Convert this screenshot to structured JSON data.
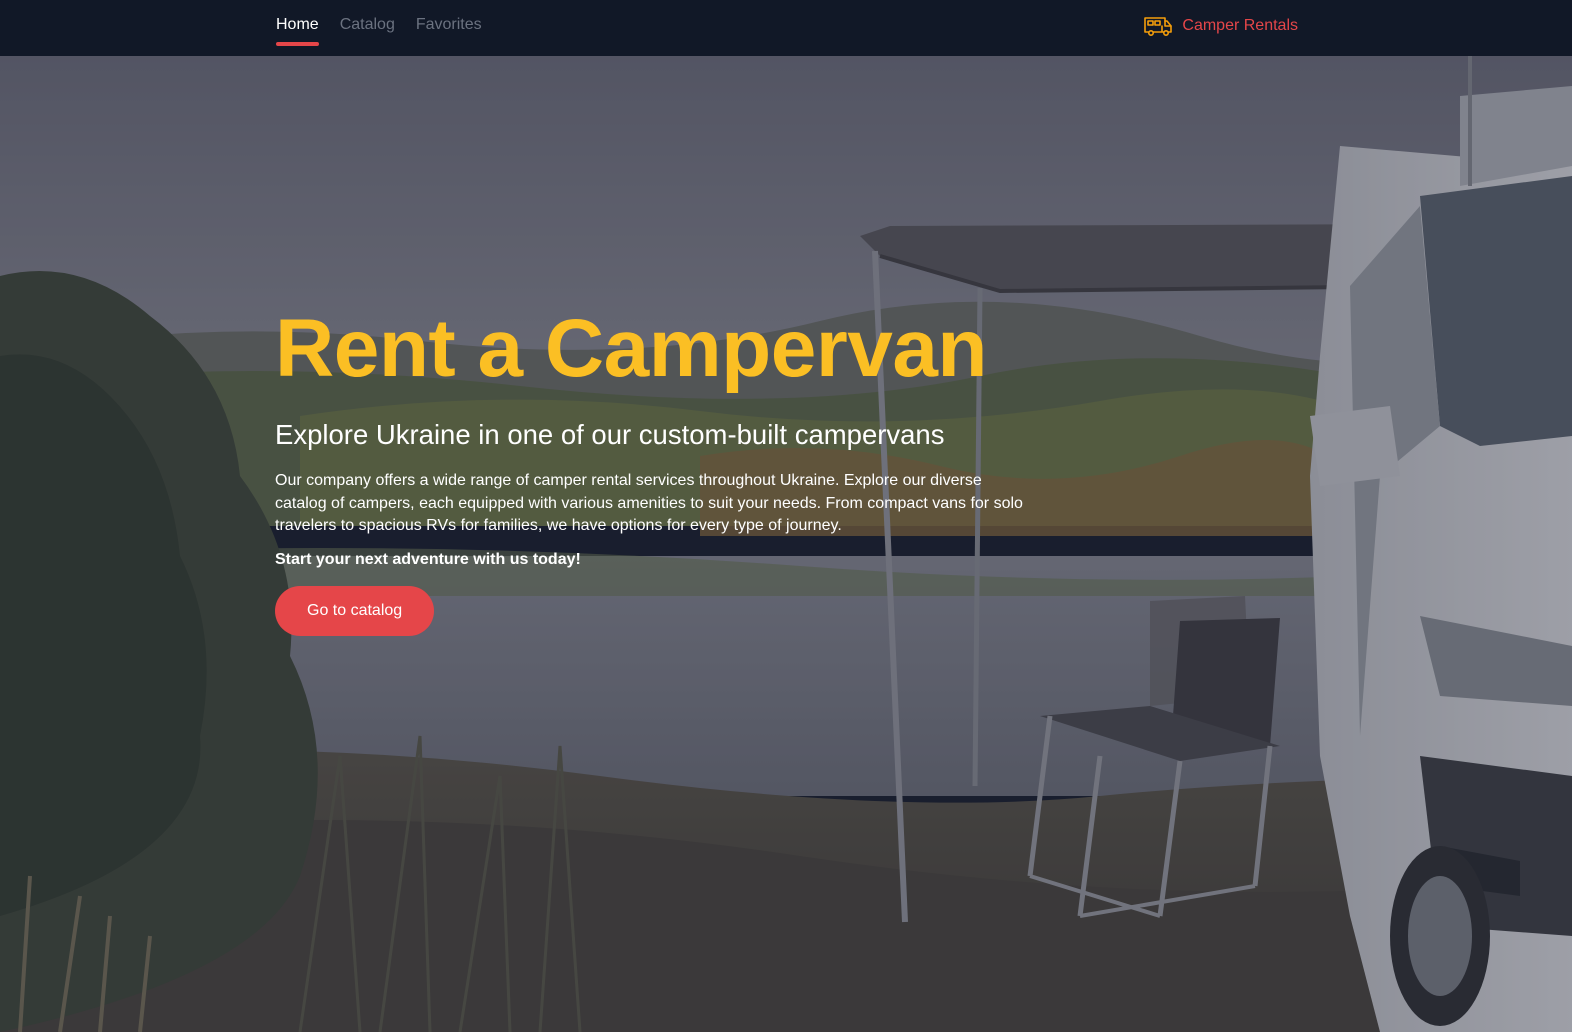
{
  "nav": {
    "items": [
      {
        "label": "Home",
        "active": true
      },
      {
        "label": "Catalog",
        "active": false
      },
      {
        "label": "Favorites",
        "active": false
      }
    ],
    "brand": {
      "label": "Camper Rentals",
      "icon": "camper-van-icon"
    }
  },
  "hero": {
    "title": "Rent a Campervan",
    "subtitle": "Explore Ukraine in one of our custom-built campervans",
    "description": "Our company offers a wide range of camper rental services throughout Ukraine. Explore our diverse catalog of campers, each equipped with various amenities to suit your needs. From compact vans for solo travelers to spacious RVs for families, we have options for every type of journey.",
    "cta_text": "Start your next adventure with us today!",
    "button_label": "Go to catalog"
  },
  "colors": {
    "nav_bg": "#111827",
    "accent": "#e54649",
    "title": "#fbbf24",
    "text": "#ffffff",
    "nav_inactive": "#6b7280"
  }
}
